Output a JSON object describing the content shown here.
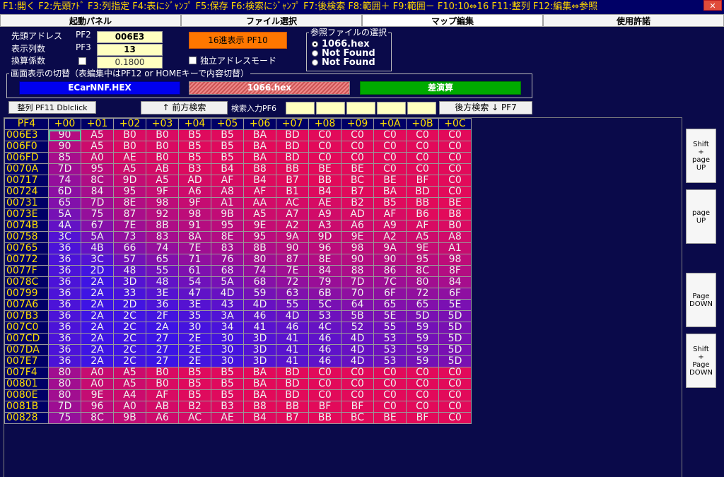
{
  "fkeys": "F1:開く F2:先頭ｱﾄﾞ F3:列指定 F4:表にｼﾞｬﾝﾌﾟ F5:保存 F6:検索にｼﾞｬﾝﾌﾟ F7:後検索 F8:範囲＋ F9:範囲－ F10:10⇔16 F11:整列 F12:編集⇔参照",
  "close_label": "✕",
  "tabs": [
    "起動パネル",
    "ファイル選択",
    "マップ編集",
    "使用許諾"
  ],
  "settings": {
    "start_addr_label": "先頭アドレス",
    "start_addr_key": "PF2",
    "start_addr_value": "006E3",
    "cols_label": "表示列数",
    "cols_key": "PF3",
    "cols_value": "13",
    "coef_label": "換算係数",
    "coef_value": "0.1800",
    "hex_button": "16進表示 PF10",
    "indep_label": "独立アドレスモード"
  },
  "ref_files": {
    "legend": "参照ファイルの選択",
    "options": [
      "1066.hex",
      "Not Found",
      "Not Found"
    ]
  },
  "display_switch": {
    "legend": "画面表示の切替（表編集中はPF12 or HOMEキーで内容切替）",
    "file_a": "ECarNNF.HEX",
    "file_b": "1066.hex",
    "diff": "差演算"
  },
  "toolbar": {
    "align": "整列 PF11 Dblclick",
    "prev_search": "↑ 前方検索",
    "search_label": "検索入力PF6",
    "next_search": "後方検索 ↓ PF7"
  },
  "colors": {
    "high": "#e0105a",
    "mid": "#3a10f0",
    "accent_orange": "#ff7700",
    "green": "#00aa00",
    "blue": "#0000ee"
  },
  "grid": {
    "corner": "PF4",
    "headers": [
      "+00",
      "+01",
      "+02",
      "+03",
      "+04",
      "+05",
      "+06",
      "+07",
      "+08",
      "+09",
      "+0A",
      "+0B",
      "+0C"
    ],
    "rows": [
      {
        "addr": "006E3",
        "cells": [
          "90",
          "A5",
          "B0",
          "B0",
          "B5",
          "B5",
          "BA",
          "BD",
          "C0",
          "C0",
          "C0",
          "C0",
          "C0"
        ]
      },
      {
        "addr": "006F0",
        "cells": [
          "90",
          "A5",
          "B0",
          "B0",
          "B5",
          "B5",
          "BA",
          "BD",
          "C0",
          "C0",
          "C0",
          "C0",
          "C0"
        ]
      },
      {
        "addr": "006FD",
        "cells": [
          "85",
          "A0",
          "AE",
          "B0",
          "B5",
          "B5",
          "BA",
          "BD",
          "C0",
          "C0",
          "C0",
          "C0",
          "C0"
        ]
      },
      {
        "addr": "0070A",
        "cells": [
          "7D",
          "95",
          "A5",
          "AB",
          "B3",
          "B4",
          "B8",
          "BB",
          "BE",
          "BE",
          "C0",
          "C0",
          "C0"
        ]
      },
      {
        "addr": "00717",
        "cells": [
          "74",
          "8C",
          "9D",
          "A5",
          "AD",
          "AF",
          "B4",
          "B7",
          "BB",
          "BC",
          "BE",
          "BF",
          "C0"
        ]
      },
      {
        "addr": "00724",
        "cells": [
          "6D",
          "84",
          "95",
          "9F",
          "A6",
          "A8",
          "AF",
          "B1",
          "B4",
          "B7",
          "BA",
          "BD",
          "C0"
        ]
      },
      {
        "addr": "00731",
        "cells": [
          "65",
          "7D",
          "8E",
          "98",
          "9F",
          "A1",
          "AA",
          "AC",
          "AE",
          "B2",
          "B5",
          "BB",
          "BE"
        ]
      },
      {
        "addr": "0073E",
        "cells": [
          "5A",
          "75",
          "87",
          "92",
          "98",
          "9B",
          "A5",
          "A7",
          "A9",
          "AD",
          "AF",
          "B6",
          "B8"
        ]
      },
      {
        "addr": "0074B",
        "cells": [
          "4A",
          "67",
          "7E",
          "8B",
          "91",
          "95",
          "9E",
          "A2",
          "A3",
          "A6",
          "A9",
          "AF",
          "B0"
        ]
      },
      {
        "addr": "00758",
        "cells": [
          "3C",
          "5A",
          "73",
          "83",
          "8A",
          "8E",
          "95",
          "9A",
          "9D",
          "9E",
          "A2",
          "A5",
          "A8"
        ]
      },
      {
        "addr": "00765",
        "cells": [
          "36",
          "4B",
          "66",
          "74",
          "7E",
          "83",
          "8B",
          "90",
          "96",
          "98",
          "9A",
          "9E",
          "A1"
        ]
      },
      {
        "addr": "00772",
        "cells": [
          "36",
          "3C",
          "57",
          "65",
          "71",
          "76",
          "80",
          "87",
          "8E",
          "90",
          "90",
          "95",
          "98"
        ]
      },
      {
        "addr": "0077F",
        "cells": [
          "36",
          "2D",
          "48",
          "55",
          "61",
          "68",
          "74",
          "7E",
          "84",
          "88",
          "86",
          "8C",
          "8F"
        ]
      },
      {
        "addr": "0078C",
        "cells": [
          "36",
          "2A",
          "3D",
          "48",
          "54",
          "5A",
          "68",
          "72",
          "79",
          "7D",
          "7C",
          "80",
          "84"
        ]
      },
      {
        "addr": "00799",
        "cells": [
          "36",
          "2A",
          "33",
          "3E",
          "47",
          "4D",
          "59",
          "63",
          "6B",
          "70",
          "6F",
          "72",
          "6F"
        ]
      },
      {
        "addr": "007A6",
        "cells": [
          "36",
          "2A",
          "2D",
          "36",
          "3E",
          "43",
          "4D",
          "55",
          "5C",
          "64",
          "65",
          "65",
          "5E"
        ]
      },
      {
        "addr": "007B3",
        "cells": [
          "36",
          "2A",
          "2C",
          "2F",
          "35",
          "3A",
          "46",
          "4D",
          "53",
          "5B",
          "5E",
          "5D",
          "5D"
        ]
      },
      {
        "addr": "007C0",
        "cells": [
          "36",
          "2A",
          "2C",
          "2A",
          "30",
          "34",
          "41",
          "46",
          "4C",
          "52",
          "55",
          "59",
          "5D"
        ]
      },
      {
        "addr": "007CD",
        "cells": [
          "36",
          "2A",
          "2C",
          "27",
          "2E",
          "30",
          "3D",
          "41",
          "46",
          "4D",
          "53",
          "59",
          "5D"
        ]
      },
      {
        "addr": "007DA",
        "cells": [
          "36",
          "2A",
          "2C",
          "27",
          "2E",
          "30",
          "3D",
          "41",
          "46",
          "4D",
          "53",
          "59",
          "5D"
        ]
      },
      {
        "addr": "007E7",
        "cells": [
          "36",
          "2A",
          "2C",
          "27",
          "2E",
          "30",
          "3D",
          "41",
          "46",
          "4D",
          "53",
          "59",
          "5D"
        ]
      },
      {
        "addr": "007F4",
        "cells": [
          "80",
          "A0",
          "A5",
          "B0",
          "B5",
          "B5",
          "BA",
          "BD",
          "C0",
          "C0",
          "C0",
          "C0",
          "C0"
        ]
      },
      {
        "addr": "00801",
        "cells": [
          "80",
          "A0",
          "A5",
          "B0",
          "B5",
          "B5",
          "BA",
          "BD",
          "C0",
          "C0",
          "C0",
          "C0",
          "C0"
        ]
      },
      {
        "addr": "0080E",
        "cells": [
          "80",
          "9E",
          "A4",
          "AF",
          "B5",
          "B5",
          "BA",
          "BD",
          "C0",
          "C0",
          "C0",
          "C0",
          "C0"
        ]
      },
      {
        "addr": "0081B",
        "cells": [
          "7D",
          "96",
          "A0",
          "AB",
          "B2",
          "B3",
          "B8",
          "BB",
          "BF",
          "BF",
          "C0",
          "C0",
          "C0"
        ]
      },
      {
        "addr": "00828",
        "cells": [
          "75",
          "8C",
          "9B",
          "A6",
          "AC",
          "AE",
          "B4",
          "B7",
          "BB",
          "BC",
          "BE",
          "BF",
          "C0"
        ]
      }
    ]
  },
  "side_buttons": [
    "Shift\n+\npage\nUP",
    "page\nUP",
    "Page\nDOWN",
    "Shift\n+\nPage\nDOWN"
  ]
}
